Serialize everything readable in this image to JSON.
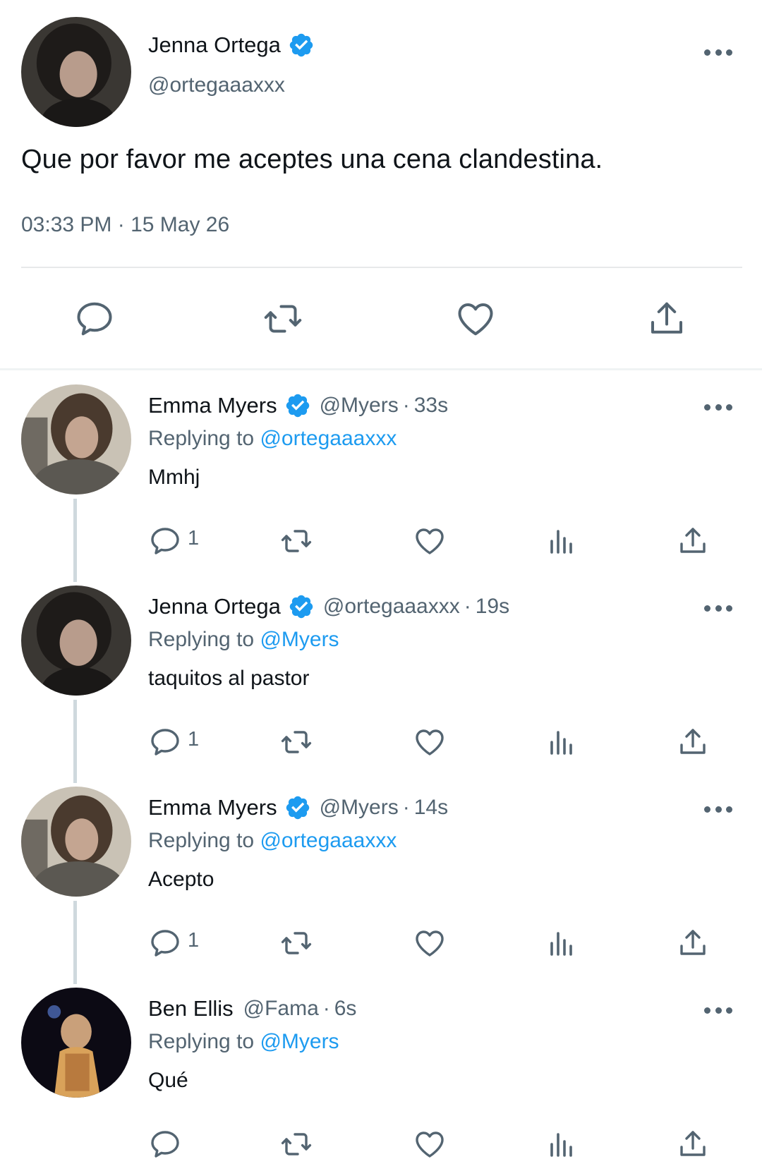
{
  "colors": {
    "text_primary": "#0f1419",
    "text_secondary": "#536471",
    "accent": "#1d9bf0",
    "divider": "#e7e9ea",
    "thread_line": "#cfd9de"
  },
  "main_tweet": {
    "author_name": "Jenna Ortega",
    "verified": true,
    "author_handle": "@ortegaaaxxx",
    "text": "Que por favor me aceptes una cena clandestina.",
    "timestamp": "03:33 PM · 15 May 26",
    "actions": [
      "reply-icon",
      "retweet-icon",
      "like-icon",
      "share-icon"
    ]
  },
  "replies": [
    {
      "author_name": "Emma Myers",
      "verified": true,
      "author_handle": "@Myers",
      "separator": "·",
      "time": "33s",
      "replying_prefix": "Replying to ",
      "replying_to": "@ortegaaaxxx",
      "text": "Mmhj",
      "reply_count": "1"
    },
    {
      "author_name": "Jenna Ortega",
      "verified": true,
      "author_handle": "@ortegaaaxxx",
      "separator": "·",
      "time": "19s",
      "replying_prefix": "Replying to ",
      "replying_to": "@Myers",
      "text": "taquitos al pastor",
      "reply_count": "1"
    },
    {
      "author_name": "Emma Myers",
      "verified": true,
      "author_handle": "@Myers",
      "separator": "·",
      "time": "14s",
      "replying_prefix": "Replying to ",
      "replying_to": "@ortegaaaxxx",
      "text": "Acepto",
      "reply_count": "1"
    },
    {
      "author_name": "Ben Ellis",
      "verified": false,
      "author_handle": "@Fama",
      "separator": "·",
      "time": "6s",
      "replying_prefix": "Replying to ",
      "replying_to": "@Myers",
      "text": "Qué",
      "reply_count": ""
    }
  ]
}
